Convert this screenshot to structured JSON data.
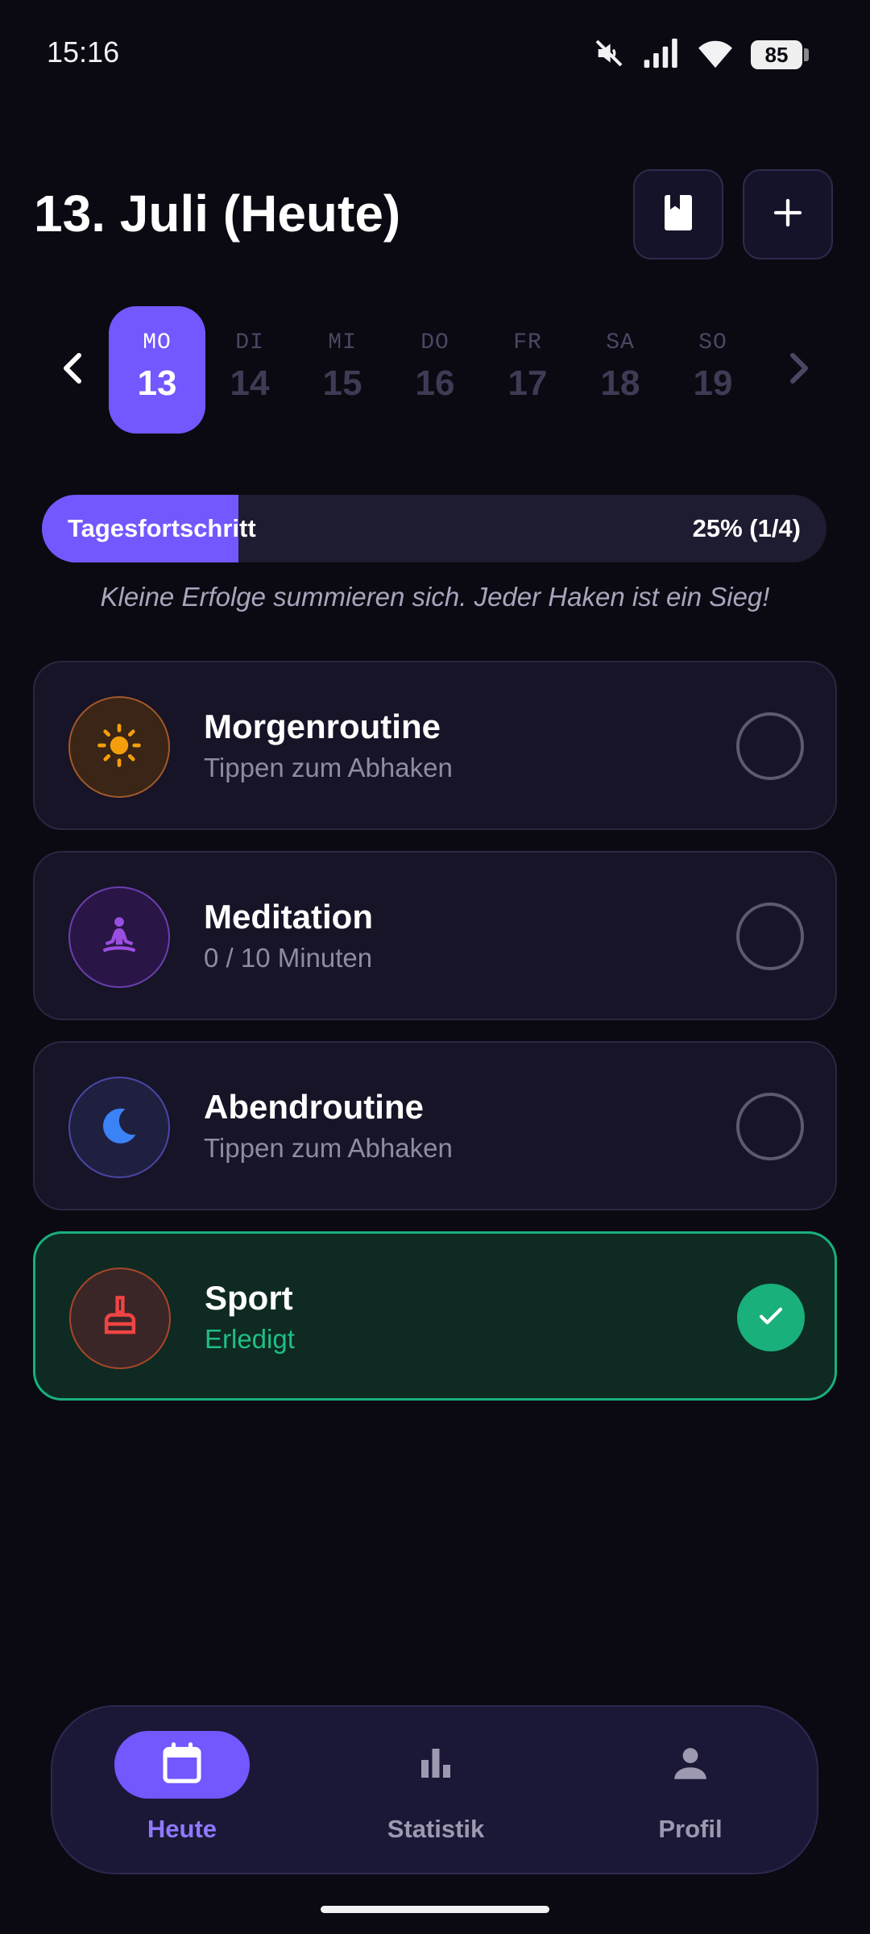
{
  "status_bar": {
    "time": "15:16",
    "battery": "85",
    "icons": [
      "mute-icon",
      "signal-icon",
      "wifi-icon",
      "battery-icon"
    ]
  },
  "header": {
    "title": "13. Juli (Heute)",
    "icons": [
      "book-icon",
      "plus-icon"
    ]
  },
  "date_strip": {
    "days": [
      {
        "abbr": "MO",
        "num": "13",
        "active": true
      },
      {
        "abbr": "DI",
        "num": "14",
        "active": false
      },
      {
        "abbr": "MI",
        "num": "15",
        "active": false
      },
      {
        "abbr": "DO",
        "num": "16",
        "active": false
      },
      {
        "abbr": "FR",
        "num": "17",
        "active": false
      },
      {
        "abbr": "SA",
        "num": "18",
        "active": false
      },
      {
        "abbr": "SO",
        "num": "19",
        "active": false
      }
    ]
  },
  "progress": {
    "label": "Tagesfortschritt",
    "value_text": "25% (1/4)",
    "fraction": 0.25
  },
  "motivation": "Kleine Erfolge summieren sich. Jeder Haken ist ein Sieg!",
  "habits": [
    {
      "name": "Morgenroutine",
      "sub": "Tippen zum Abhaken",
      "icon": "sun-icon",
      "color": "#f59e0b",
      "done": false
    },
    {
      "name": "Meditation",
      "sub": "0 / 10 Minuten",
      "icon": "meditation-icon",
      "color": "#9b4fe0",
      "done": false
    },
    {
      "name": "Abendroutine",
      "sub": "Tippen zum Abhaken",
      "icon": "moon-icon",
      "color": "#3b82f6",
      "done": false
    },
    {
      "name": "Sport",
      "sub": "Erledigt",
      "icon": "cleaning-brush-icon",
      "color": "#ef4444",
      "done": true
    }
  ],
  "nav": {
    "items": [
      {
        "label": "Heute",
        "icon": "calendar-icon",
        "active": true
      },
      {
        "label": "Statistik",
        "icon": "bar-chart-icon",
        "active": false
      },
      {
        "label": "Profil",
        "icon": "person-icon",
        "active": false
      }
    ]
  },
  "colors": {
    "accent": "#7357ff",
    "success": "#19b07c",
    "background": "#0b0a12",
    "card": "#161426"
  }
}
